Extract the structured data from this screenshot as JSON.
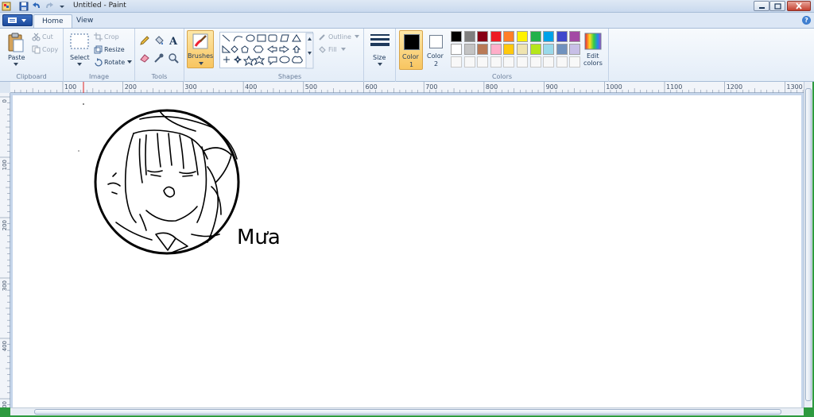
{
  "window": {
    "title": "Untitled - Paint"
  },
  "tabs": [
    {
      "label": "Home"
    },
    {
      "label": "View"
    }
  ],
  "clipboard": {
    "paste": "Paste",
    "cut": "Cut",
    "copy": "Copy",
    "group": "Clipboard"
  },
  "image": {
    "select": "Select",
    "crop": "Crop",
    "resize": "Resize",
    "rotate": "Rotate",
    "group": "Image"
  },
  "tools": {
    "group": "Tools"
  },
  "brushes": {
    "label": "Brushes"
  },
  "shapes": {
    "outline": "Outline",
    "fill": "Fill",
    "group": "Shapes"
  },
  "size": {
    "label": "Size"
  },
  "colors": {
    "color1_label": "Color",
    "color1_num": "1",
    "color2_label": "Color",
    "color2_num": "2",
    "edit_label": "Edit",
    "edit_label2": "colors",
    "group": "Colors",
    "color1": "#000000",
    "color2": "#ffffff",
    "row1": [
      "#000000",
      "#7f7f7f",
      "#880015",
      "#ed1c24",
      "#ff7f27",
      "#fff200",
      "#22b14c",
      "#00a2e8",
      "#3f48cc",
      "#a349a4"
    ],
    "row2": [
      "#ffffff",
      "#c3c3c3",
      "#b97a57",
      "#ffaec9",
      "#ffc90e",
      "#efe4b0",
      "#b5e61d",
      "#99d9ea",
      "#7092be",
      "#c8bfe7"
    ]
  },
  "ruler": {
    "h_labels": [
      "100",
      "200",
      "300",
      "400",
      "500",
      "600",
      "700",
      "800",
      "900",
      "1000",
      "1100",
      "1200",
      "1300"
    ],
    "v_labels": [
      "0",
      "100",
      "200",
      "300",
      "400",
      "500"
    ]
  },
  "canvas": {
    "signature": "Mưa"
  }
}
